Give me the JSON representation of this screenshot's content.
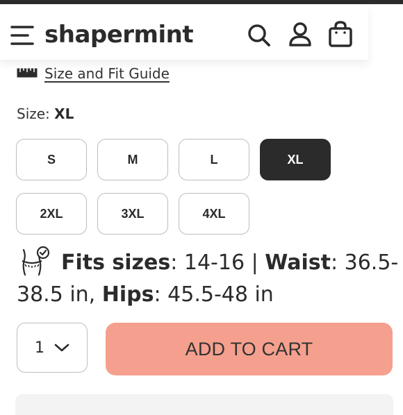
{
  "header": {
    "logo_text": "shapermint",
    "icons": [
      "menu-icon",
      "search-icon",
      "account-icon",
      "shopping-bag-icon"
    ]
  },
  "size_guide": {
    "label": "Size and Fit Guide",
    "icon": "ruler-icon"
  },
  "size": {
    "label": "Size:",
    "selected": "XL",
    "options": [
      "S",
      "M",
      "L",
      "XL",
      "2XL",
      "3XL",
      "4XL"
    ]
  },
  "fit_info": {
    "icon": "body-measure-icon",
    "fits_label": "Fits sizes",
    "fits_value": ": 14-16 | ",
    "waist_label": "Waist",
    "waist_value": ": 36.5-",
    "waist_value_cont": "38.5 in, ",
    "hips_label": "Hips",
    "hips_value": ": 45.5-48 in"
  },
  "quantity": {
    "value": "1"
  },
  "cart": {
    "button_label": "ADD TO CART"
  },
  "colors": {
    "accent": "#f5a08e",
    "selected": "#2b2b2b",
    "border": "#bdbdbd"
  }
}
